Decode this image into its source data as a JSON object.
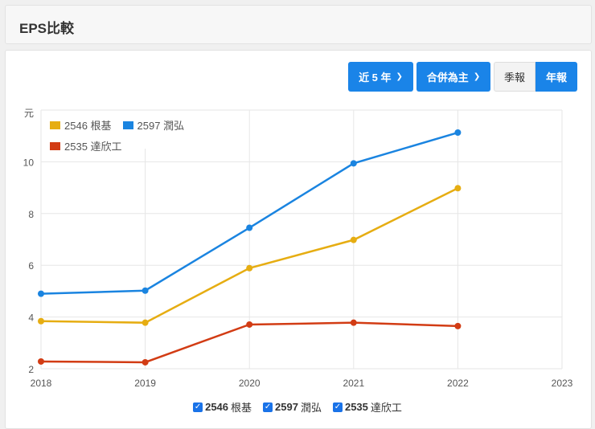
{
  "header": {
    "title": "EPS比較"
  },
  "controls": {
    "period": "近 5 年",
    "scope": "合併為主",
    "quarterly": "季報",
    "annual": "年報"
  },
  "chart_data": {
    "type": "line",
    "title": "EPS比較",
    "ylabel": "元",
    "x": [
      2018,
      2019,
      2020,
      2021,
      2022
    ],
    "xticks": [
      "2018",
      "2019",
      "2020",
      "2021",
      "2022",
      "2023"
    ],
    "yticks": [
      "2",
      "4",
      "6",
      "8",
      "10"
    ],
    "xlim": [
      2018,
      2023
    ],
    "ylim": [
      2,
      12
    ],
    "legend": "top-left",
    "series": [
      {
        "name": "2546 根基",
        "label": "2546",
        "name_zh": "根基",
        "color": "#e6ad12",
        "values": [
          3.84,
          3.78,
          5.89,
          6.98,
          8.98
        ]
      },
      {
        "name": "2597 潤弘",
        "label": "2597",
        "name_zh": "潤弘",
        "color": "#1a84e0",
        "values": [
          4.9,
          5.02,
          7.45,
          9.94,
          11.13
        ]
      },
      {
        "name": "2535 達欣工",
        "label": "2535",
        "name_zh": "達欣工",
        "color": "#d23c14",
        "values": [
          2.28,
          2.25,
          3.71,
          3.78,
          3.65
        ]
      }
    ]
  }
}
